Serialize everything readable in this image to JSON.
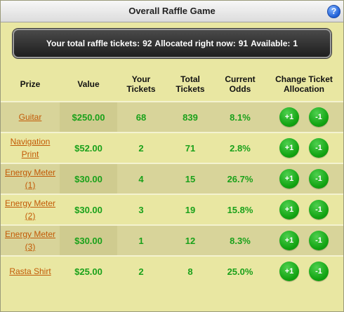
{
  "window": {
    "title": "Overall Raffle Game"
  },
  "summary": {
    "total_label": "Your total raffle tickets:",
    "total_value": "92",
    "allocated_label": "Allocated right now:",
    "allocated_value": "91",
    "available_label": "Available:",
    "available_value": "1"
  },
  "table": {
    "headers": {
      "prize": "Prize",
      "value": "Value",
      "your_tickets": "Your\nTickets",
      "total_tickets": "Total\nTickets",
      "current_odds": "Current\nOdds",
      "change": "Change Ticket\nAllocation"
    },
    "rows": [
      {
        "prize": "Guitar",
        "value": "$250.00",
        "your_tickets": "68",
        "total_tickets": "839",
        "odds": "8.1%",
        "plus": "+1",
        "minus": "-1"
      },
      {
        "prize": "Navigation Print",
        "value": "$52.00",
        "your_tickets": "2",
        "total_tickets": "71",
        "odds": "2.8%",
        "plus": "+1",
        "minus": "-1"
      },
      {
        "prize": "Energy Meter (1)",
        "value": "$30.00",
        "your_tickets": "4",
        "total_tickets": "15",
        "odds": "26.7%",
        "plus": "+1",
        "minus": "-1"
      },
      {
        "prize": "Energy Meter (2)",
        "value": "$30.00",
        "your_tickets": "3",
        "total_tickets": "19",
        "odds": "15.8%",
        "plus": "+1",
        "minus": "-1"
      },
      {
        "prize": "Energy Meter (3)",
        "value": "$30.00",
        "your_tickets": "1",
        "total_tickets": "12",
        "odds": "8.3%",
        "plus": "+1",
        "minus": "-1"
      },
      {
        "prize": "Rasta Shirt",
        "value": "$25.00",
        "your_tickets": "2",
        "total_tickets": "8",
        "odds": "25.0%",
        "plus": "+1",
        "minus": "-1"
      }
    ]
  },
  "colors": {
    "accent": "#1aa11a",
    "link": "#c25a06",
    "background": "#e9e7a2"
  }
}
